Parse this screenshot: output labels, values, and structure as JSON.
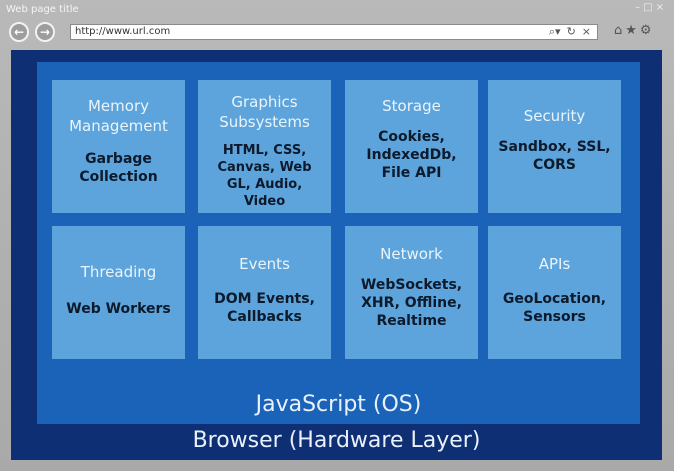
{
  "window": {
    "title": "Web page title",
    "address_url": "http://www.url.com",
    "min_glyph": "–",
    "max_glyph": "□",
    "close_glyph": "×",
    "back_glyph": "←",
    "forward_glyph": "→",
    "search_glyph": "⌕▾",
    "refresh_glyph": "↻",
    "stop_glyph": "×",
    "home_glyph": "⌂",
    "favorites_glyph": "★",
    "settings_glyph": "⚙"
  },
  "diagram": {
    "tiles": [
      {
        "title": "Memory Management",
        "body": "Garbage Collection"
      },
      {
        "title": "Graphics Subsystems",
        "body": "HTML, CSS, Canvas, Web GL, Audio, Video"
      },
      {
        "title": "Storage",
        "body": "Cookies, IndexedDb, File API"
      },
      {
        "title": "Security",
        "body": "Sandbox, SSL, CORS"
      },
      {
        "title": "Threading",
        "body": "Web Workers"
      },
      {
        "title": "Events",
        "body": "DOM Events, Callbacks"
      },
      {
        "title": "Network",
        "body": "WebSockets, XHR, Offline, Realtime"
      },
      {
        "title": "APIs",
        "body": "GeoLocation, Sensors"
      }
    ],
    "os_layer_label": "JavaScript (OS)",
    "browser_layer_label": "Browser (Hardware Layer)"
  },
  "colors": {
    "browser_layer": "#0e2f73",
    "os_layer": "#1a63b8",
    "tile": "#5ca4db"
  }
}
